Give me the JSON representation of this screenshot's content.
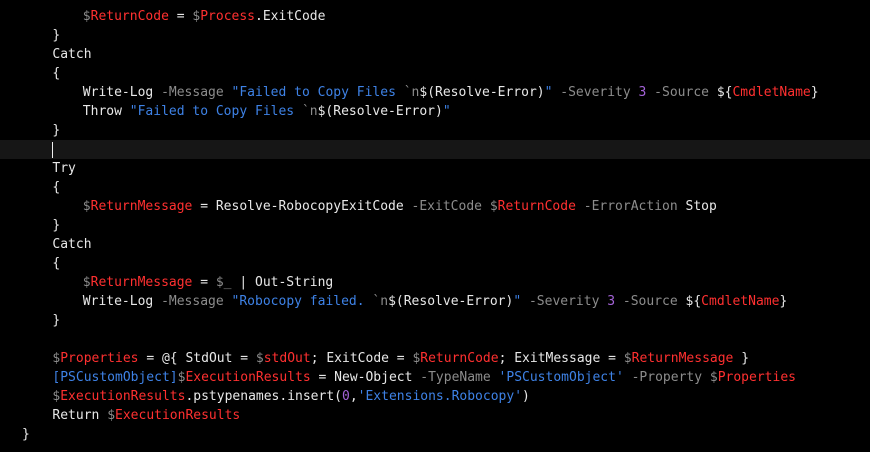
{
  "colors": {
    "background": "#000000",
    "current_line": "#161616",
    "default_text": "#e8e8e8",
    "variable_sigil": "#8c8c8c",
    "variable_name": "#ff3030",
    "string": "#3e82e6",
    "number": "#a463d8",
    "type": "#3e82e6"
  },
  "lines": [
    {
      "indent": 8,
      "tokens": [
        [
          "var",
          "$"
        ],
        [
          "vred",
          "ReturnCode"
        ],
        [
          "dflt",
          " = "
        ],
        [
          "var",
          "$"
        ],
        [
          "vred",
          "Process"
        ],
        [
          "dflt",
          ".ExitCode"
        ]
      ]
    },
    {
      "indent": 4,
      "tokens": [
        [
          "dflt",
          "}"
        ]
      ]
    },
    {
      "indent": 4,
      "tokens": [
        [
          "dflt",
          "Catch"
        ]
      ]
    },
    {
      "indent": 4,
      "tokens": [
        [
          "dflt",
          "{"
        ]
      ]
    },
    {
      "indent": 8,
      "tokens": [
        [
          "dflt",
          "Write-Log "
        ],
        [
          "var",
          "-Message "
        ],
        [
          "str",
          "\"Failed to Copy Files "
        ],
        [
          "esc",
          "`n"
        ],
        [
          "dflt",
          "$(Resolve-Error)"
        ],
        [
          "str",
          "\""
        ],
        [
          "var",
          " -Severity "
        ],
        [
          "num",
          "3"
        ],
        [
          "var",
          " -Source "
        ],
        [
          "dflt",
          "${"
        ],
        [
          "vred",
          "CmdletName"
        ],
        [
          "dflt",
          "}"
        ]
      ]
    },
    {
      "indent": 8,
      "tokens": [
        [
          "dflt",
          "Throw "
        ],
        [
          "str",
          "\"Failed to Copy Files "
        ],
        [
          "esc",
          "`n"
        ],
        [
          "dflt",
          "$(Resolve-Error)"
        ],
        [
          "str",
          "\""
        ]
      ]
    },
    {
      "indent": 4,
      "tokens": [
        [
          "dflt",
          "}"
        ]
      ]
    },
    {
      "indent": 4,
      "tokens": [],
      "current": true
    },
    {
      "indent": 4,
      "tokens": [
        [
          "dflt",
          "Try"
        ]
      ]
    },
    {
      "indent": 4,
      "tokens": [
        [
          "dflt",
          "{"
        ]
      ]
    },
    {
      "indent": 8,
      "tokens": [
        [
          "var",
          "$"
        ],
        [
          "vred",
          "ReturnMessage"
        ],
        [
          "dflt",
          " = Resolve-RobocopyExitCode "
        ],
        [
          "var",
          "-ExitCode "
        ],
        [
          "var",
          "$"
        ],
        [
          "vred",
          "ReturnCode"
        ],
        [
          "var",
          " -ErrorAction "
        ],
        [
          "dflt",
          "Stop"
        ]
      ]
    },
    {
      "indent": 4,
      "tokens": [
        [
          "dflt",
          "}"
        ]
      ]
    },
    {
      "indent": 4,
      "tokens": [
        [
          "dflt",
          "Catch"
        ]
      ]
    },
    {
      "indent": 4,
      "tokens": [
        [
          "dflt",
          "{"
        ]
      ]
    },
    {
      "indent": 8,
      "tokens": [
        [
          "var",
          "$"
        ],
        [
          "vred",
          "ReturnMessage"
        ],
        [
          "dflt",
          " = "
        ],
        [
          "var",
          "$_"
        ],
        [
          "dflt",
          " | Out-String"
        ]
      ]
    },
    {
      "indent": 8,
      "tokens": [
        [
          "dflt",
          "Write-Log "
        ],
        [
          "var",
          "-Message "
        ],
        [
          "str",
          "\"Robocopy failed. "
        ],
        [
          "esc",
          "`n"
        ],
        [
          "dflt",
          "$(Resolve-Error)"
        ],
        [
          "str",
          "\""
        ],
        [
          "var",
          " -Severity "
        ],
        [
          "num",
          "3"
        ],
        [
          "var",
          " -Source "
        ],
        [
          "dflt",
          "${"
        ],
        [
          "vred",
          "CmdletName"
        ],
        [
          "dflt",
          "}"
        ]
      ]
    },
    {
      "indent": 4,
      "tokens": [
        [
          "dflt",
          "}"
        ]
      ]
    },
    {
      "indent": 0,
      "tokens": []
    },
    {
      "indent": 4,
      "tokens": [
        [
          "var",
          "$"
        ],
        [
          "vred",
          "Properties"
        ],
        [
          "dflt",
          " = @{ StdOut = "
        ],
        [
          "var",
          "$"
        ],
        [
          "vred",
          "stdOut"
        ],
        [
          "dflt",
          "; ExitCode = "
        ],
        [
          "var",
          "$"
        ],
        [
          "vred",
          "ReturnCode"
        ],
        [
          "dflt",
          "; ExitMessage = "
        ],
        [
          "var",
          "$"
        ],
        [
          "vred",
          "ReturnMessage"
        ],
        [
          "dflt",
          " }"
        ]
      ]
    },
    {
      "indent": 4,
      "tokens": [
        [
          "type",
          "[PSCustomObject]"
        ],
        [
          "var",
          "$"
        ],
        [
          "vred",
          "ExecutionResults"
        ],
        [
          "dflt",
          " = New-Object "
        ],
        [
          "var",
          "-TypeName "
        ],
        [
          "str",
          "'PSCustomObject'"
        ],
        [
          "var",
          " -Property "
        ],
        [
          "var",
          "$"
        ],
        [
          "vred",
          "Properties"
        ]
      ]
    },
    {
      "indent": 4,
      "tokens": [
        [
          "var",
          "$"
        ],
        [
          "vred",
          "ExecutionResults"
        ],
        [
          "dflt",
          ".pstypenames.insert("
        ],
        [
          "num",
          "0"
        ],
        [
          "dflt",
          ","
        ],
        [
          "str",
          "'Extensions.Robocopy'"
        ],
        [
          "dflt",
          ")"
        ]
      ]
    },
    {
      "indent": 4,
      "tokens": [
        [
          "dflt",
          "Return "
        ],
        [
          "var",
          "$"
        ],
        [
          "vred",
          "ExecutionResults"
        ]
      ]
    },
    {
      "indent": 0,
      "tokens": [
        [
          "dflt",
          "}"
        ]
      ]
    }
  ]
}
